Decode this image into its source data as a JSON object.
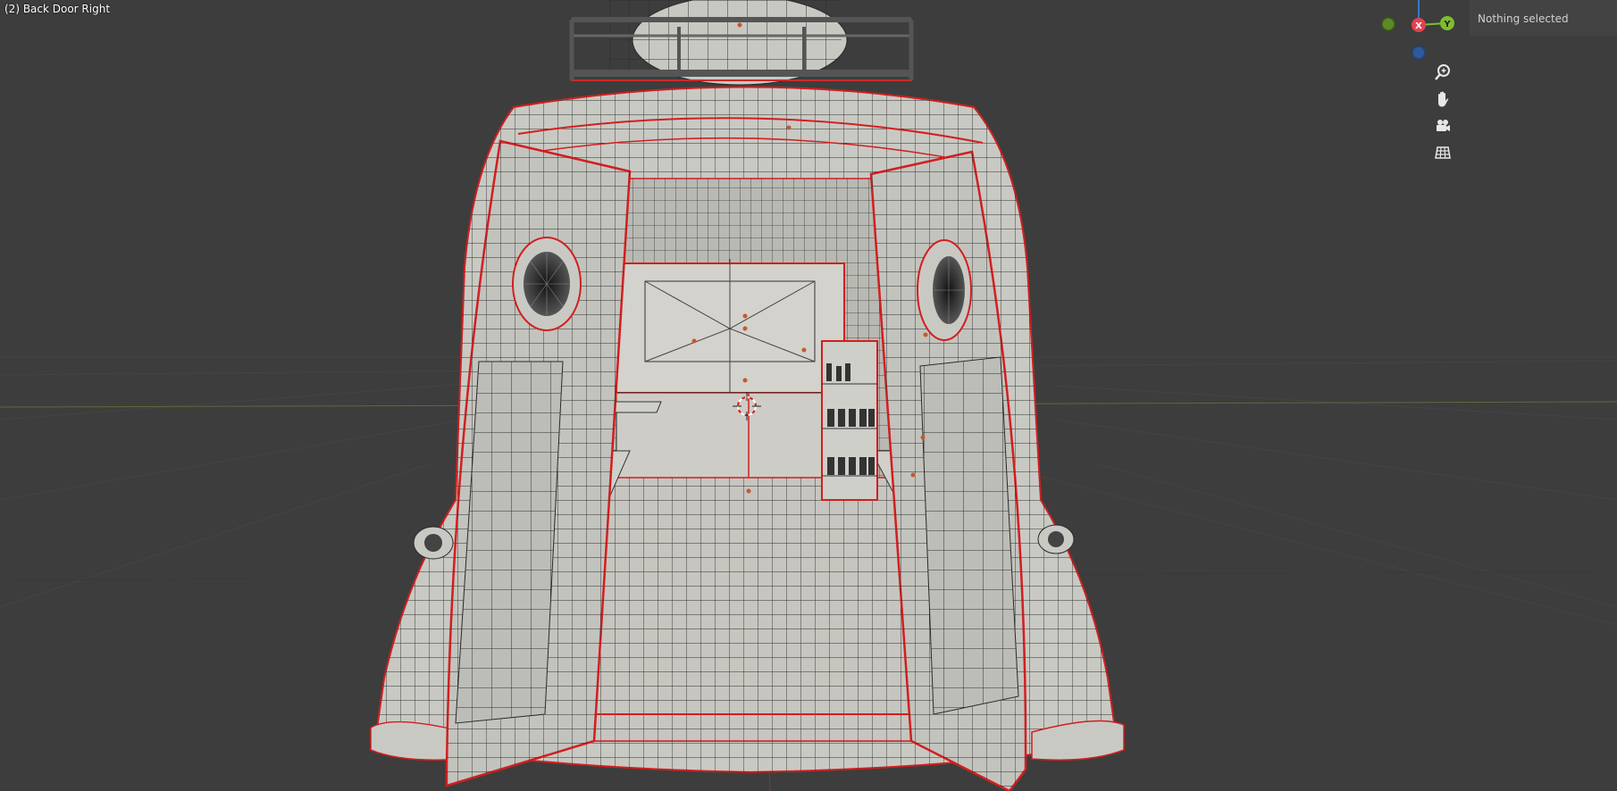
{
  "viewport": {
    "object_label": "(2) Back Door Right"
  },
  "status": {
    "selection_text": "Nothing selected"
  },
  "gizmo": {
    "x_label": "X",
    "y_label": "Y",
    "colors": {
      "x": "#e3414f",
      "y": "#7dbf2c",
      "z": "#3b74c9",
      "neg_y": "#5d8a25",
      "neg_z": "#2c5a9c"
    }
  },
  "nav_icons": [
    "zoom-icon",
    "hand-pan-icon",
    "camera-icon",
    "grid-ortho-icon"
  ],
  "theme": {
    "background": "#3d3d3d",
    "mesh_fill": "#c9c9c4",
    "wire": "#2a2a2a",
    "selection_outline": "#d21f1f",
    "origin_dot": "#c6582e"
  }
}
